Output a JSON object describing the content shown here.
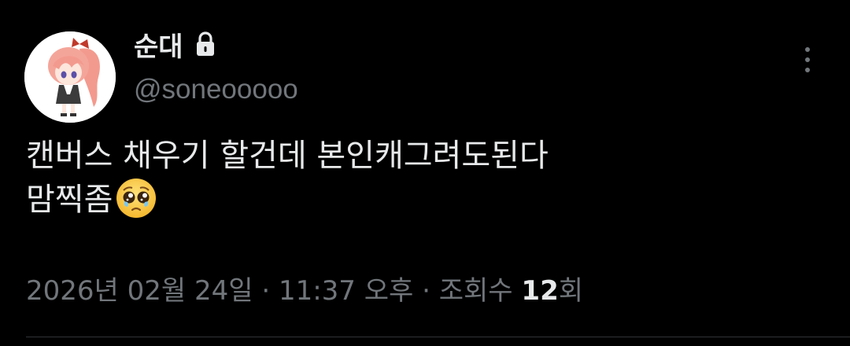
{
  "author": {
    "display_name": "순대",
    "handle": "@soneooooo",
    "locked_icon": "lock-icon",
    "avatar_icon": "anime-character-avatar"
  },
  "more_icon": "more-vertical-icon",
  "post": {
    "line1": "캔버스 채우기 할건데 본인캐그려도된다",
    "line2": "맘찍좀",
    "emoji": "pleading-face-emoji"
  },
  "meta": {
    "date": "2026년 02월 24일",
    "sep1": " · ",
    "time": "11:37 오후",
    "sep2": " · ",
    "views_label": "조회수 ",
    "views_count": "12",
    "views_suffix": "회"
  },
  "colors": {
    "background": "#000000",
    "primary_text": "#e7e9ea",
    "secondary_text": "#71767b",
    "divider": "#2f3336"
  }
}
